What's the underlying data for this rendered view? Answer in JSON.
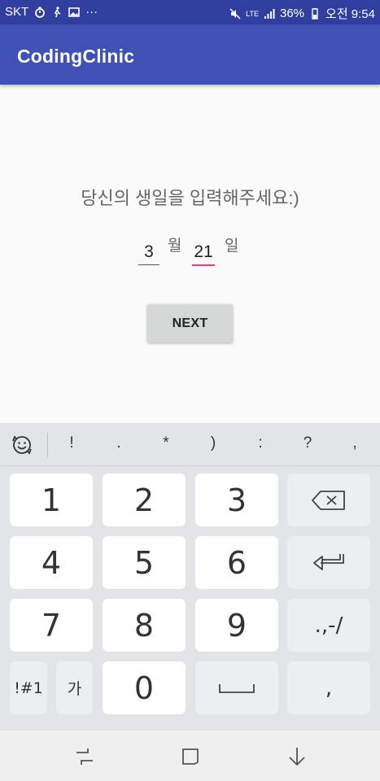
{
  "status_bar": {
    "carrier": "SKT",
    "ellipsis": "···",
    "network": "LTE",
    "battery": "36%",
    "time": "오전 9:54"
  },
  "app_bar": {
    "title": "CodingClinic"
  },
  "main": {
    "prompt": "당신의 생일을 입력해주세요:)",
    "month_value": "3",
    "month_unit": "월",
    "day_value": "21",
    "day_unit": "일",
    "next_label": "NEXT"
  },
  "keyboard": {
    "symbols": [
      "!",
      ".",
      "*",
      ")",
      ":",
      "?",
      ","
    ],
    "keys": {
      "k1": "1",
      "k2": "2",
      "k3": "3",
      "k4": "4",
      "k5": "5",
      "k6": "6",
      "k7": "7",
      "k8": "8",
      "k9": "9",
      "k0": "0",
      "punct": ".,-/",
      "sym_toggle": "!#1",
      "korean": "가",
      "comma": ","
    }
  },
  "colors": {
    "status_bar": "#303f9f",
    "app_bar": "#3f51b5",
    "day_underline": "#e5398a",
    "button": "#d6d7d7",
    "keyboard_bg": "#e2e4e8"
  }
}
